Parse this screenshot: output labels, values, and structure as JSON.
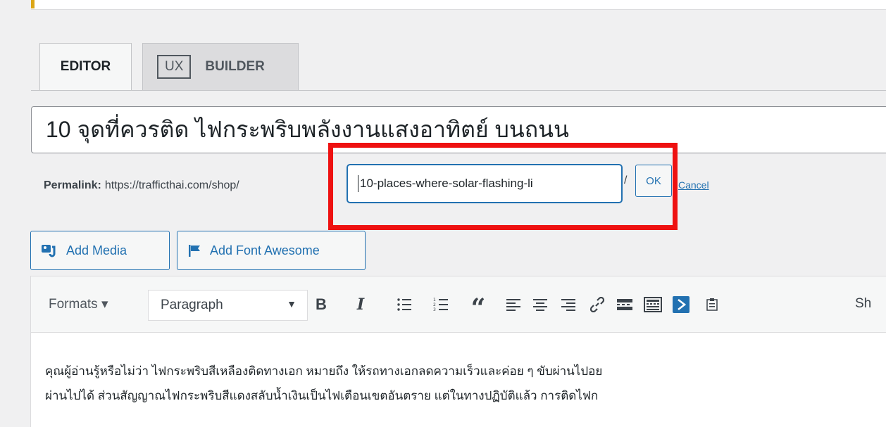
{
  "tabs": [
    {
      "label": "EDITOR"
    },
    {
      "prefix": "UX",
      "label": "BUILDER"
    }
  ],
  "post_title": "10 จุดที่ควรติด ไฟกระพริบพลังงานแสงอาทิตย์ บนถนน",
  "permalink": {
    "label": "Permalink:",
    "base_url": "https://trafficthai.com/shop/",
    "slug_value": "10-places-where-solar-flashing-li",
    "trailing_slash": "/",
    "ok_label": "OK",
    "cancel_label": "Cancel"
  },
  "media_buttons": {
    "add_media": "Add Media",
    "add_font_awesome": "Add Font Awesome"
  },
  "toolbar": {
    "formats_label": "Formats ▾",
    "paragraph_value": "Paragraph",
    "bold": "B",
    "italic": "I",
    "quote": "“",
    "show_label": "Sh"
  },
  "body": {
    "line1": "คุณผู้อ่านรู้หรือไม่ว่า ไฟกระพริบสีเหลืองติดทางเอก หมายถึง ให้รถทางเอกลดความเร็วและค่อย ๆ ขับผ่านไปอย",
    "line2": "ผ่านไปได้ ส่วนสัญญาณไฟกระพริบสีแดงสลับน้ำเงินเป็นไฟเตือนเขตอันตราย แต่ในทางปฏิบัติแล้ว การติดไฟก"
  },
  "colors": {
    "accent": "#2271b1",
    "highlight": "#ee1111",
    "notice": "#dba617"
  }
}
